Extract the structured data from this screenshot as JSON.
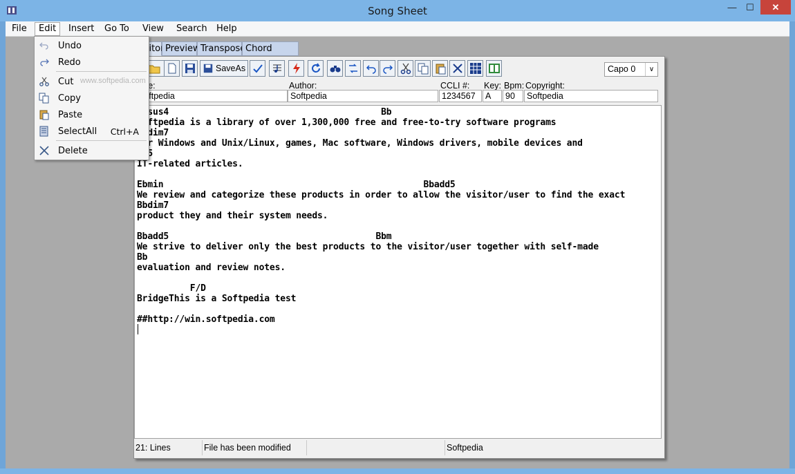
{
  "window": {
    "title": "Song Sheet",
    "min": "—",
    "max": "☐",
    "close": "✕"
  },
  "menubar": [
    "File",
    "Edit",
    "Insert",
    "Go To",
    "View",
    "Search",
    "Help"
  ],
  "tabs": [
    "Editor",
    "Preview",
    "Transpose",
    "Chord Editor"
  ],
  "toolbar": {
    "saveas_label": "SaveAs",
    "capo_value": "Capo 0",
    "capo_arrow": "∨"
  },
  "fields": {
    "title_label": "Title:",
    "title_value": "Softpedia",
    "author_label": "Author:",
    "author_value": "Softpedia",
    "ccli_label": "CCLI #:",
    "ccli_value": "1234567",
    "key_label": "Key:",
    "key_value": "A",
    "bpm_label": "Bpm:",
    "bpm_value": "90",
    "copyright_label": "Copyright:",
    "copyright_value": "Softpedia"
  },
  "editor_lines": [
    "Bbsus4                                        Bb",
    "Softpedia is a library of over 1,300,000 free and free-to-try software programs",
    "Bbdim7",
    "for Windows and Unix/Linux, games, Mac software, Windows drivers, mobile devices and",
    "Bb5",
    "IT-related articles.",
    "",
    "Ebmin                                                 Bbadd5",
    "We review and categorize these products in order to allow the visitor/user to find the exact",
    "Bbdim7",
    "product they and their system needs.",
    "",
    "Bbadd5                                       Bbm",
    "We strive to deliver only the best products to the visitor/user together with self-made",
    "Bb",
    "evaluation and review notes.",
    "",
    "          F/D",
    "BridgeThis is a Softpedia test",
    "",
    "##http://win.softpedia.com"
  ],
  "statusbar": {
    "lines": "21: Lines",
    "modified": "File has been modified",
    "empty": "",
    "author": "Softpedia"
  },
  "edit_menu": {
    "watermark": "www.softpedia.com",
    "items": [
      {
        "label": "Undo",
        "icon": "undo-icon",
        "shortcut": ""
      },
      {
        "label": "Redo",
        "icon": "redo-icon",
        "shortcut": ""
      },
      {
        "label": "Cut",
        "icon": "scissors-icon",
        "shortcut": ""
      },
      {
        "label": "Copy",
        "icon": "copy-icon",
        "shortcut": ""
      },
      {
        "label": "Paste",
        "icon": "paste-icon",
        "shortcut": ""
      },
      {
        "label": "SelectAll",
        "icon": "select-all-icon",
        "shortcut": "Ctrl+A"
      },
      {
        "label": "Delete",
        "icon": "delete-x-icon",
        "shortcut": ""
      }
    ]
  },
  "colors": {
    "titlebar": "#7cb4e6",
    "workspace": "#aaaaaa",
    "close": "#c7443b"
  }
}
